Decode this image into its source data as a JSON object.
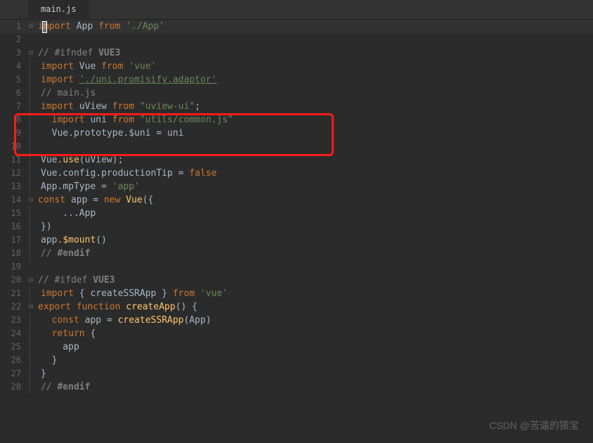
{
  "tab": {
    "filename": "main.js"
  },
  "lines": [
    {
      "n": 1,
      "fold": "⊟",
      "tokens": [
        [
          "kw",
          "import"
        ],
        [
          "id",
          " App "
        ],
        [
          "kw",
          "from"
        ],
        [
          "id",
          " "
        ],
        [
          "str",
          "'./App'"
        ]
      ],
      "hl": true
    },
    {
      "n": 2,
      "fold": "",
      "tokens": []
    },
    {
      "n": 3,
      "fold": "⊟",
      "tokens": [
        [
          "cm",
          "// "
        ],
        [
          "cm",
          "#ifndef "
        ],
        [
          "cm-b",
          "VUE3"
        ]
      ]
    },
    {
      "n": 4,
      "fold": "|",
      "tokens": [
        [
          "kw",
          "import"
        ],
        [
          "id",
          " Vue "
        ],
        [
          "kw",
          "from"
        ],
        [
          "id",
          " "
        ],
        [
          "str",
          "'vue'"
        ]
      ]
    },
    {
      "n": 5,
      "fold": "|",
      "tokens": [
        [
          "kw",
          "import"
        ],
        [
          "id",
          " "
        ],
        [
          "str-u",
          "'./uni.promisify.adaptor'"
        ]
      ]
    },
    {
      "n": 6,
      "fold": "|",
      "tokens": [
        [
          "cm",
          "// main.js"
        ]
      ]
    },
    {
      "n": 7,
      "fold": "|",
      "tokens": [
        [
          "kw",
          "import"
        ],
        [
          "id",
          " uView "
        ],
        [
          "kw",
          "from"
        ],
        [
          "id",
          " "
        ],
        [
          "str",
          "\"uview-ui\""
        ],
        [
          "id",
          ";"
        ]
      ]
    },
    {
      "n": 8,
      "fold": "|",
      "tokens": [
        [
          "id",
          "  "
        ],
        [
          "kw",
          "import"
        ],
        [
          "id",
          " uni "
        ],
        [
          "kw",
          "from"
        ],
        [
          "id",
          " "
        ],
        [
          "str",
          "\"utils/common.js\""
        ]
      ]
    },
    {
      "n": 9,
      "fold": "|",
      "tokens": [
        [
          "id",
          "  Vue.prototype.$uni = uni"
        ]
      ]
    },
    {
      "n": 10,
      "fold": "|",
      "tokens": []
    },
    {
      "n": 11,
      "fold": "|",
      "tokens": [
        [
          "id",
          "Vue."
        ],
        [
          "fn",
          "use"
        ],
        [
          "id",
          "(uView);"
        ]
      ]
    },
    {
      "n": 12,
      "fold": "|",
      "tokens": [
        [
          "id",
          "Vue.config.productionTip = "
        ],
        [
          "kw",
          "false"
        ]
      ]
    },
    {
      "n": 13,
      "fold": "|",
      "tokens": [
        [
          "id",
          "App.mpType = "
        ],
        [
          "str",
          "'app'"
        ]
      ]
    },
    {
      "n": 14,
      "fold": "⊟",
      "tokens": [
        [
          "kw",
          "const"
        ],
        [
          "id",
          " app = "
        ],
        [
          "kw",
          "new"
        ],
        [
          "id",
          " "
        ],
        [
          "fn",
          "Vue"
        ],
        [
          "id",
          "({"
        ]
      ]
    },
    {
      "n": 15,
      "fold": "|",
      "tokens": [
        [
          "id",
          "    ...App"
        ]
      ]
    },
    {
      "n": 16,
      "fold": "|",
      "tokens": [
        [
          "id",
          "})"
        ]
      ]
    },
    {
      "n": 17,
      "fold": "|",
      "tokens": [
        [
          "id",
          "app."
        ],
        [
          "fn",
          "$mount"
        ],
        [
          "id",
          "()"
        ]
      ]
    },
    {
      "n": 18,
      "fold": "|",
      "tokens": [
        [
          "cm",
          "// "
        ],
        [
          "cm-b",
          "#endif"
        ]
      ]
    },
    {
      "n": 19,
      "fold": "",
      "tokens": []
    },
    {
      "n": 20,
      "fold": "⊟",
      "tokens": [
        [
          "cm",
          "// "
        ],
        [
          "cm",
          "#ifdef "
        ],
        [
          "cm-b",
          "VUE3"
        ]
      ]
    },
    {
      "n": 21,
      "fold": "|",
      "tokens": [
        [
          "kw",
          "import"
        ],
        [
          "id",
          " { createSSRApp } "
        ],
        [
          "kw",
          "from"
        ],
        [
          "id",
          " "
        ],
        [
          "str",
          "'vue'"
        ]
      ]
    },
    {
      "n": 22,
      "fold": "⊟",
      "tokens": [
        [
          "kw",
          "export"
        ],
        [
          "id",
          " "
        ],
        [
          "kw",
          "function"
        ],
        [
          "id",
          " "
        ],
        [
          "fn",
          "createApp"
        ],
        [
          "id",
          "() {"
        ]
      ]
    },
    {
      "n": 23,
      "fold": "|",
      "tokens": [
        [
          "id",
          "  "
        ],
        [
          "kw",
          "const"
        ],
        [
          "id",
          " app = "
        ],
        [
          "fn",
          "createSSRApp"
        ],
        [
          "id",
          "(App)"
        ]
      ]
    },
    {
      "n": 24,
      "fold": "|",
      "tokens": [
        [
          "id",
          "  "
        ],
        [
          "kw",
          "return"
        ],
        [
          "id",
          " {"
        ]
      ]
    },
    {
      "n": 25,
      "fold": "|",
      "tokens": [
        [
          "id",
          "    app"
        ]
      ]
    },
    {
      "n": 26,
      "fold": "|",
      "tokens": [
        [
          "id",
          "  }"
        ]
      ]
    },
    {
      "n": 27,
      "fold": "|",
      "tokens": [
        [
          "id",
          "}"
        ]
      ]
    },
    {
      "n": 28,
      "fold": "|",
      "tokens": [
        [
          "cm",
          "// "
        ],
        [
          "cm-b",
          "#endif"
        ]
      ]
    }
  ],
  "watermark": "CSDN @苦逼的猿宝"
}
